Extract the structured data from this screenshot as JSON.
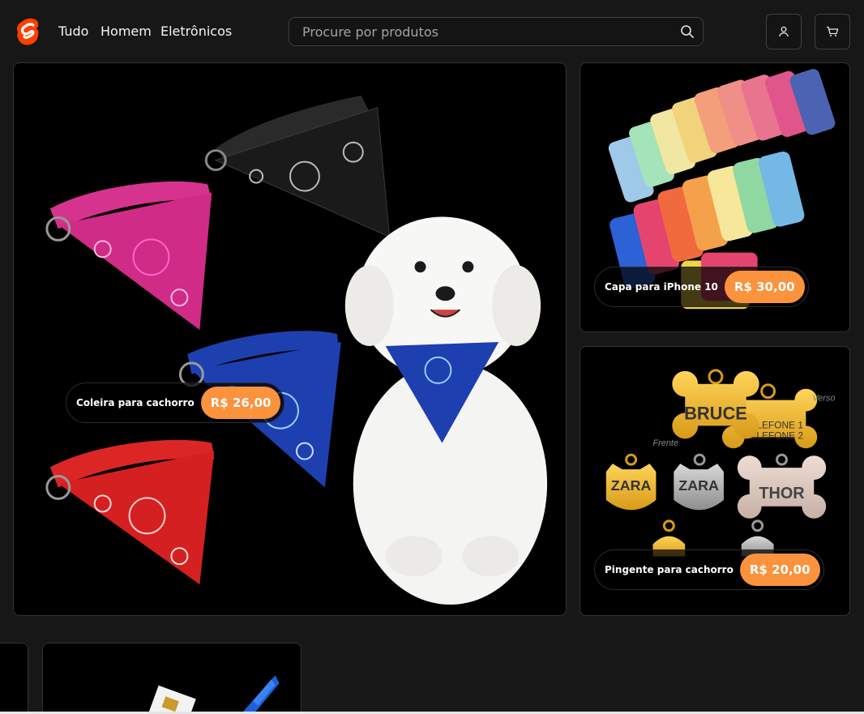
{
  "header": {
    "logo": "svelte-logo-icon",
    "nav": [
      "Tudo",
      "Homem",
      "Eletrônicos"
    ],
    "search": {
      "placeholder": "Procure por produtos",
      "value": "",
      "icon": "search-icon"
    },
    "account_icon": "user-icon",
    "cart_icon": "cart-icon"
  },
  "featured": [
    {
      "name": "Coleira para cachorro",
      "price": "R$ 26,00"
    },
    {
      "name": "Capa para iPhone 10",
      "price": "R$ 30,00"
    },
    {
      "name": "Pingente para cachorro",
      "price": "R$ 20,00"
    }
  ],
  "tag_art": {
    "bone_1": "BRUCE",
    "bone_2_line_1": "TELEFONE 1",
    "bone_2_line_2": "TELEFONE 2",
    "label_front": "Frente",
    "label_back": "Verso",
    "cat_gold": "ZARA",
    "cat_silver": "ZARA",
    "bone_3": "THOR"
  },
  "colors": {
    "background": "#171717",
    "tile_background": "#000000",
    "accent_orange": "#fb923c",
    "logo_orange": "#ff3e00"
  }
}
